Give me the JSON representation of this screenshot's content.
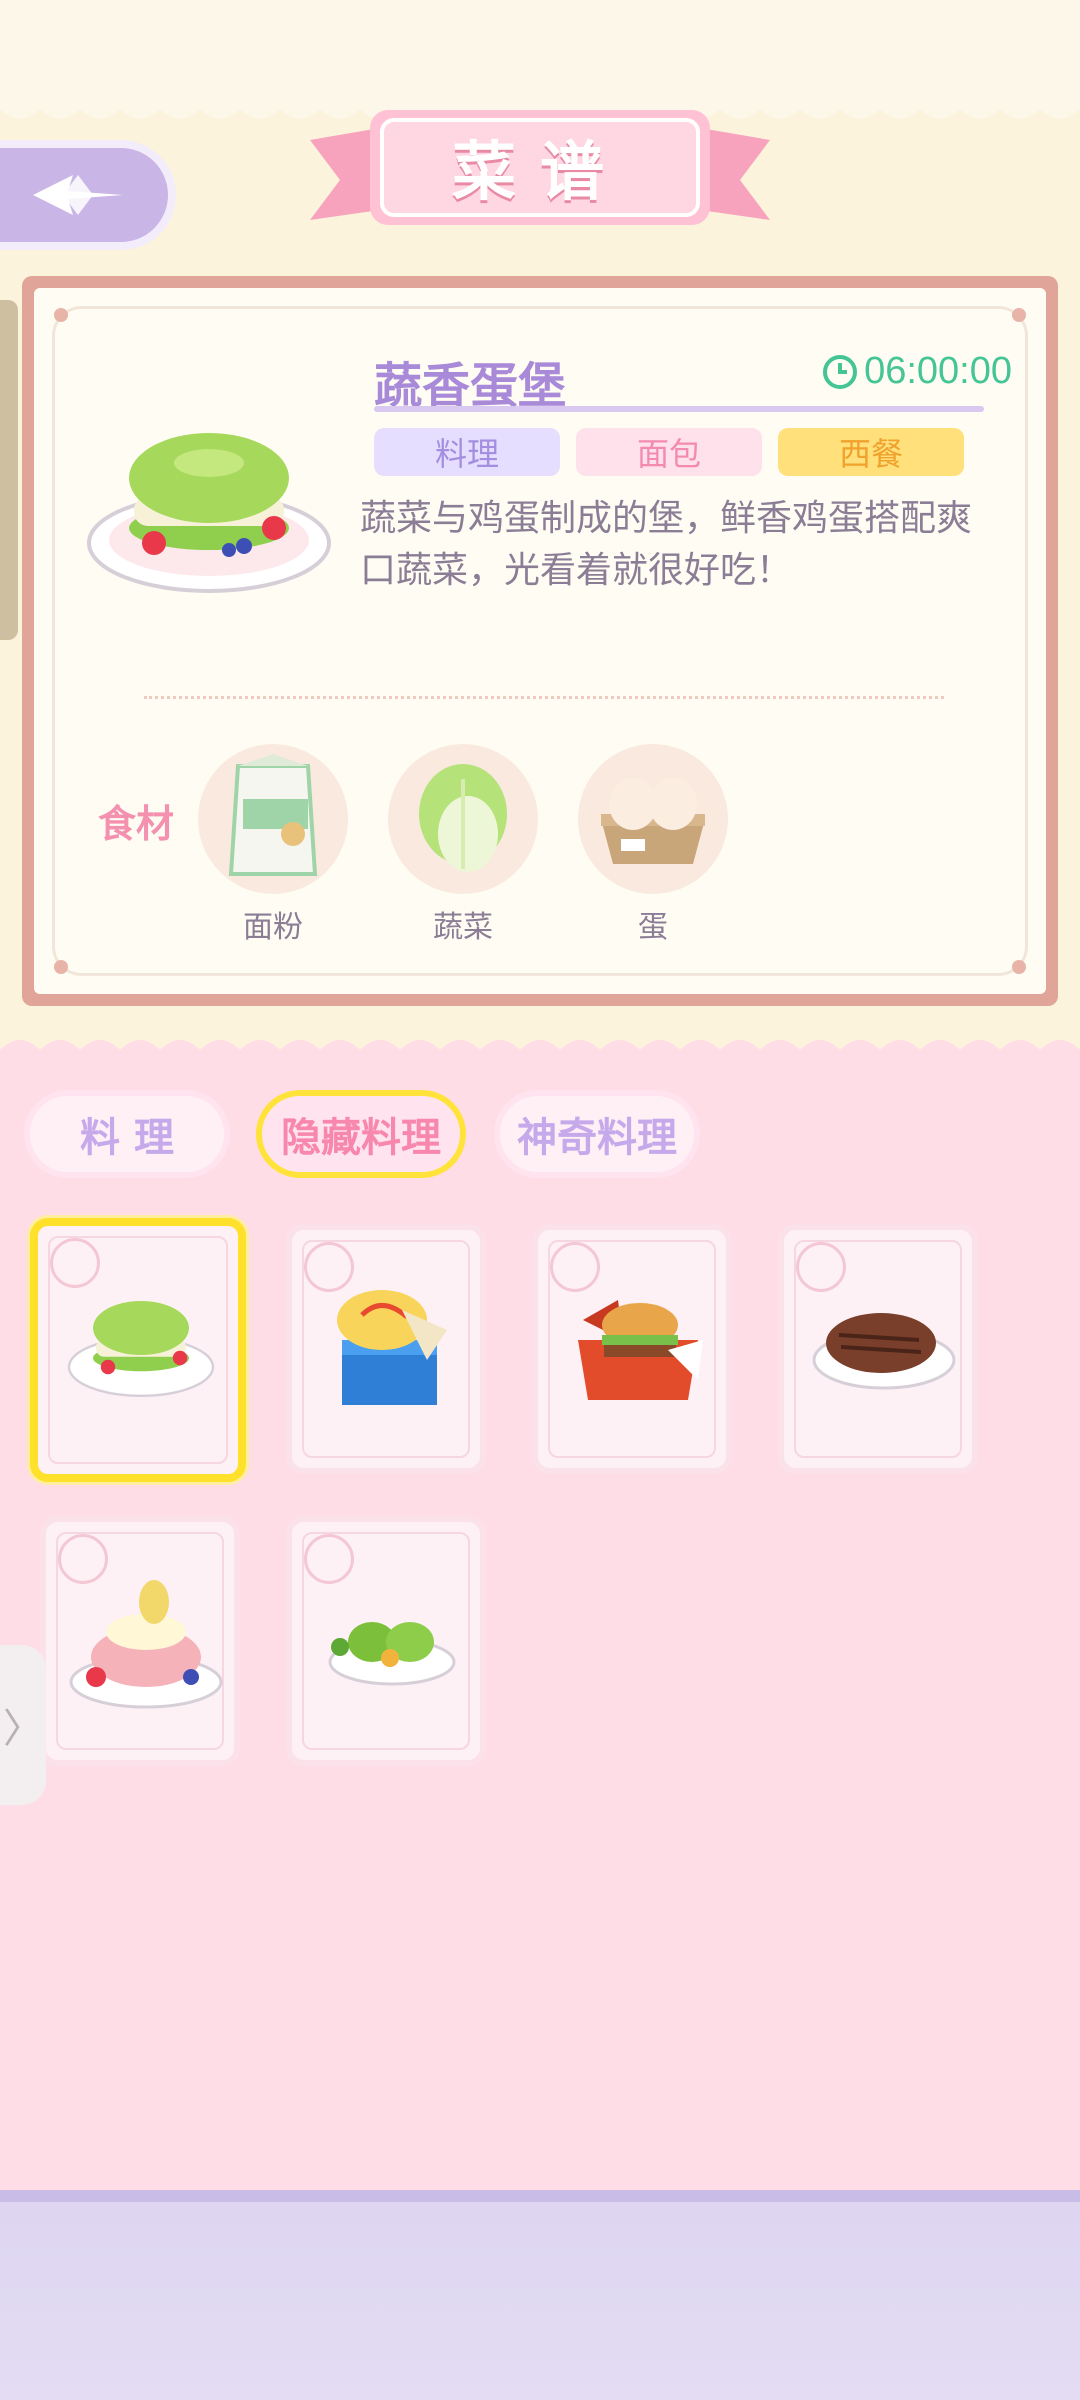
{
  "title": "菜谱",
  "back_icon": "diamond-back-icon",
  "recipe": {
    "name": "蔬香蛋堡",
    "timer": "06:00:00",
    "tags": [
      {
        "label": "料理",
        "bg": "#e5deff",
        "color": "#a48ee0"
      },
      {
        "label": "面包",
        "bg": "#ffe1ec",
        "color": "#f38ab0"
      },
      {
        "label": "西餐",
        "bg": "#ffe07a",
        "color": "#f0a22d"
      }
    ],
    "description": "蔬菜与鸡蛋制成的堡，鲜香鸡蛋搭配爽口蔬菜，光看着就很好吃！",
    "ingredients_label": "食材",
    "ingredients": [
      {
        "label": "面粉",
        "icon": "flour-bag-icon"
      },
      {
        "label": "蔬菜",
        "icon": "cabbage-icon"
      },
      {
        "label": "蛋",
        "icon": "egg-carton-icon"
      }
    ]
  },
  "tabs": [
    {
      "label": "料 理",
      "active": false
    },
    {
      "label": "隐藏料理",
      "active": true
    },
    {
      "label": "神奇料理",
      "active": false
    }
  ],
  "dishes": [
    {
      "icon": "green-egg-burger-icon",
      "selected": true
    },
    {
      "icon": "omelette-box-icon",
      "selected": false
    },
    {
      "icon": "burger-box-icon",
      "selected": false
    },
    {
      "icon": "steak-icon",
      "selected": false
    },
    {
      "icon": "pudding-dessert-icon",
      "selected": false
    },
    {
      "icon": "green-dumplings-icon",
      "selected": false
    }
  ],
  "side_tab_glyph": "〉",
  "colors": {
    "accent_purple": "#a88ad8",
    "accent_pink": "#f491b0",
    "timer_green": "#45c495",
    "highlight_yellow": "#ffe02b"
  }
}
